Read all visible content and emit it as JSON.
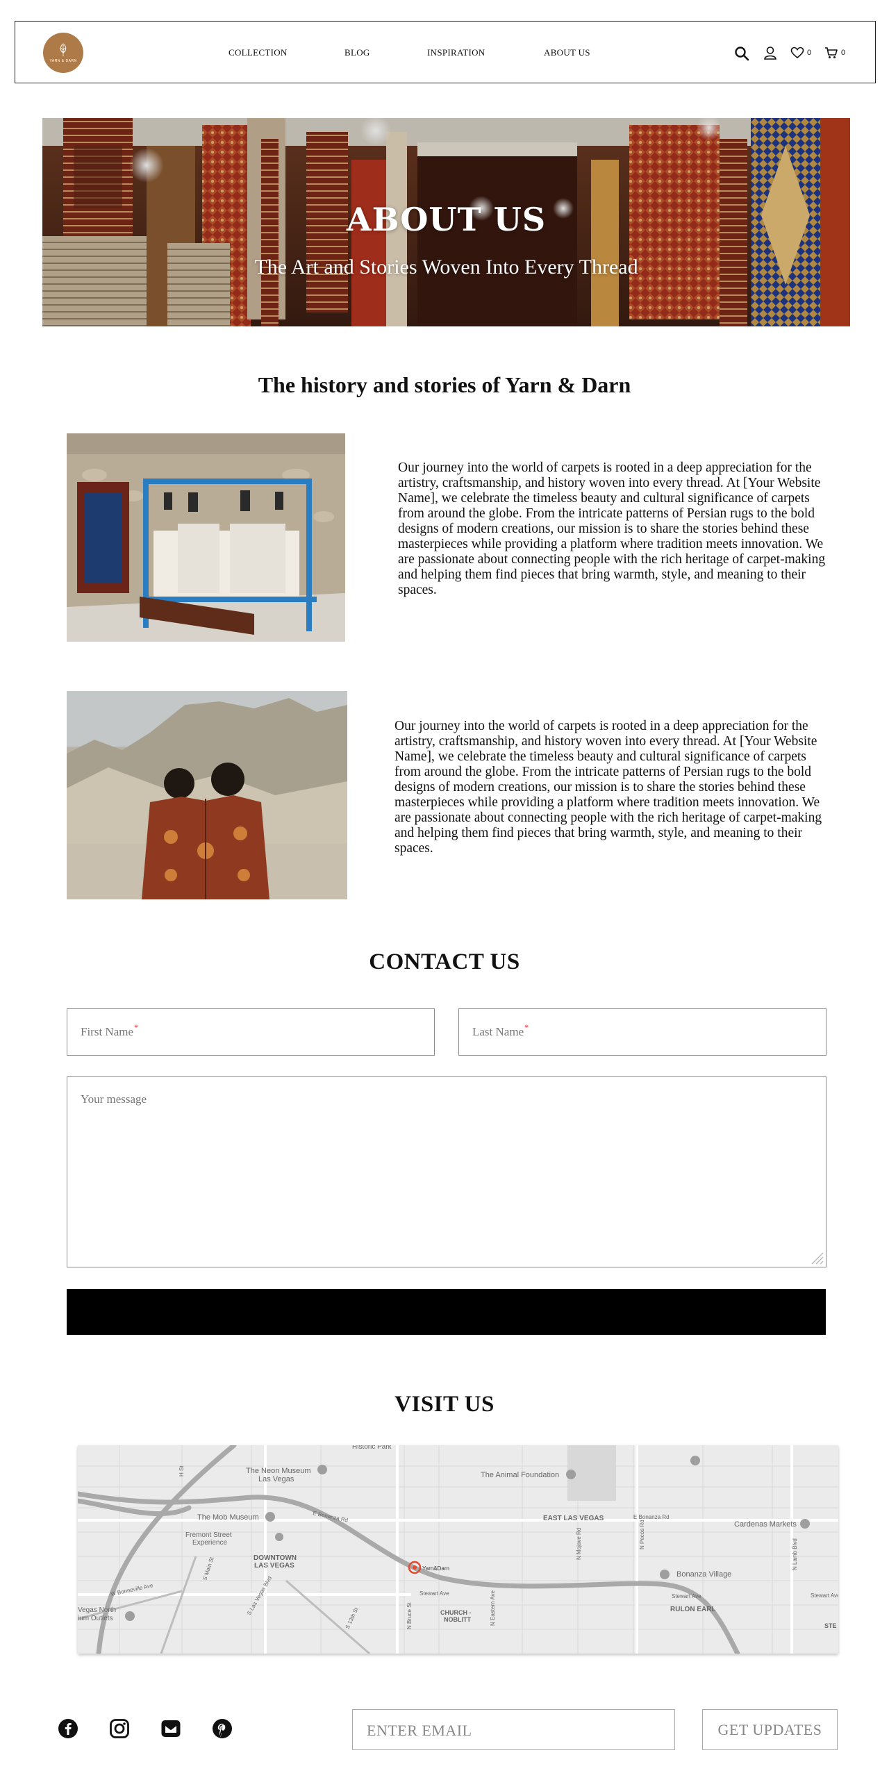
{
  "brand": {
    "logo_text": "YARN & DARN",
    "accent_color": "#ad7a48"
  },
  "nav": {
    "items": [
      "COLLECTION",
      "BLOG",
      "INSPIRATION",
      "ABOUT US"
    ]
  },
  "header_icons": {
    "search": "search-icon",
    "account": "user-icon",
    "wishlist_count": "0",
    "cart_count": "0"
  },
  "hero": {
    "title": "ABOUT US",
    "subtitle": "The Art and Stories Woven Into Every Thread"
  },
  "history": {
    "title": "The history and stories of Yarn & Darn",
    "stories": [
      "Our journey into the world of carpets is rooted in a deep appreciation for the artistry, craftsmanship, and history woven into every thread. At [Your Website Name], we celebrate the timeless beauty and cultural significance of carpets from around the globe. From the intricate patterns of Persian rugs to the bold designs of modern creations, our mission is to share the stories behind these masterpieces while providing a platform where tradition meets innovation. We are passionate about connecting people with the rich heritage of carpet-making and helping them find pieces that bring warmth, style, and meaning to their spaces.",
      "Our journey into the world of carpets is rooted in a deep appreciation for the artistry, craftsmanship, and history woven into every thread. At [Your Website Name], we celebrate the timeless beauty and cultural significance of carpets from around the globe. From the intricate patterns of Persian rugs to the bold designs of modern creations, our mission is to share the stories behind these masterpieces while providing a platform where tradition meets innovation. We are passionate about connecting people with the rich heritage of carpet-making and helping them find pieces that bring warmth, style, and meaning to their spaces."
    ]
  },
  "contact": {
    "title": "CONTACT US",
    "first_name_placeholder": "First Name",
    "last_name_placeholder": "Last Name",
    "required_mark": "*",
    "message_placeholder": "Your message",
    "submit_label": ""
  },
  "visit": {
    "title": "VISIT US",
    "map_labels": {
      "historic_park": "Historic Park",
      "neon_museum": "The Neon Museum",
      "neon_museum_2": "Las Vegas",
      "animal_foundation": "The Animal Foundation",
      "mob_museum": "The Mob Museum",
      "fremont": "Fremont Street",
      "fremont_2": "Experience",
      "downtown": "DOWNTOWN",
      "downtown_2": "LAS VEGAS",
      "east_lv": "EAST LAS VEGAS",
      "cardenas": "Cardenas Markets",
      "bonanza_village": "Bonanza Village",
      "rulon": "RULON EARL",
      "church": "CHURCH -",
      "church_2": "NOBLITT",
      "pin": "Yarn&Darn",
      "bonanza_rd": "E Bonanza Rd",
      "bonanza_rd_2": "E Bonanza Rd",
      "stewart": "Stewart Ave",
      "stewart_2": "Stewart Ave",
      "stewart_3": "Stewart Ave",
      "w_bonneville": "W Bonneville Ave",
      "vegas_north": "Vegas North",
      "vegas_north_2": "ium Outlets",
      "main_st": "S Main St",
      "lv_blvd": "S Las Vegas Blvd",
      "s13th": "S 13th St",
      "n_bruce": "N Bruce St",
      "n_eastern": "N Eastern Ave",
      "n_mojave": "N Mojave Rd",
      "n_pecos": "N Pecos Rd",
      "n_lamb": "N Lamb Blvd",
      "ste": "STE",
      "h_st": "H St"
    }
  },
  "footer": {
    "socials": [
      "facebook-icon",
      "instagram-icon",
      "mail-icon",
      "pinterest-icon"
    ],
    "email_placeholder": "ENTER EMAIL",
    "updates_label": "GET UPDATES"
  }
}
